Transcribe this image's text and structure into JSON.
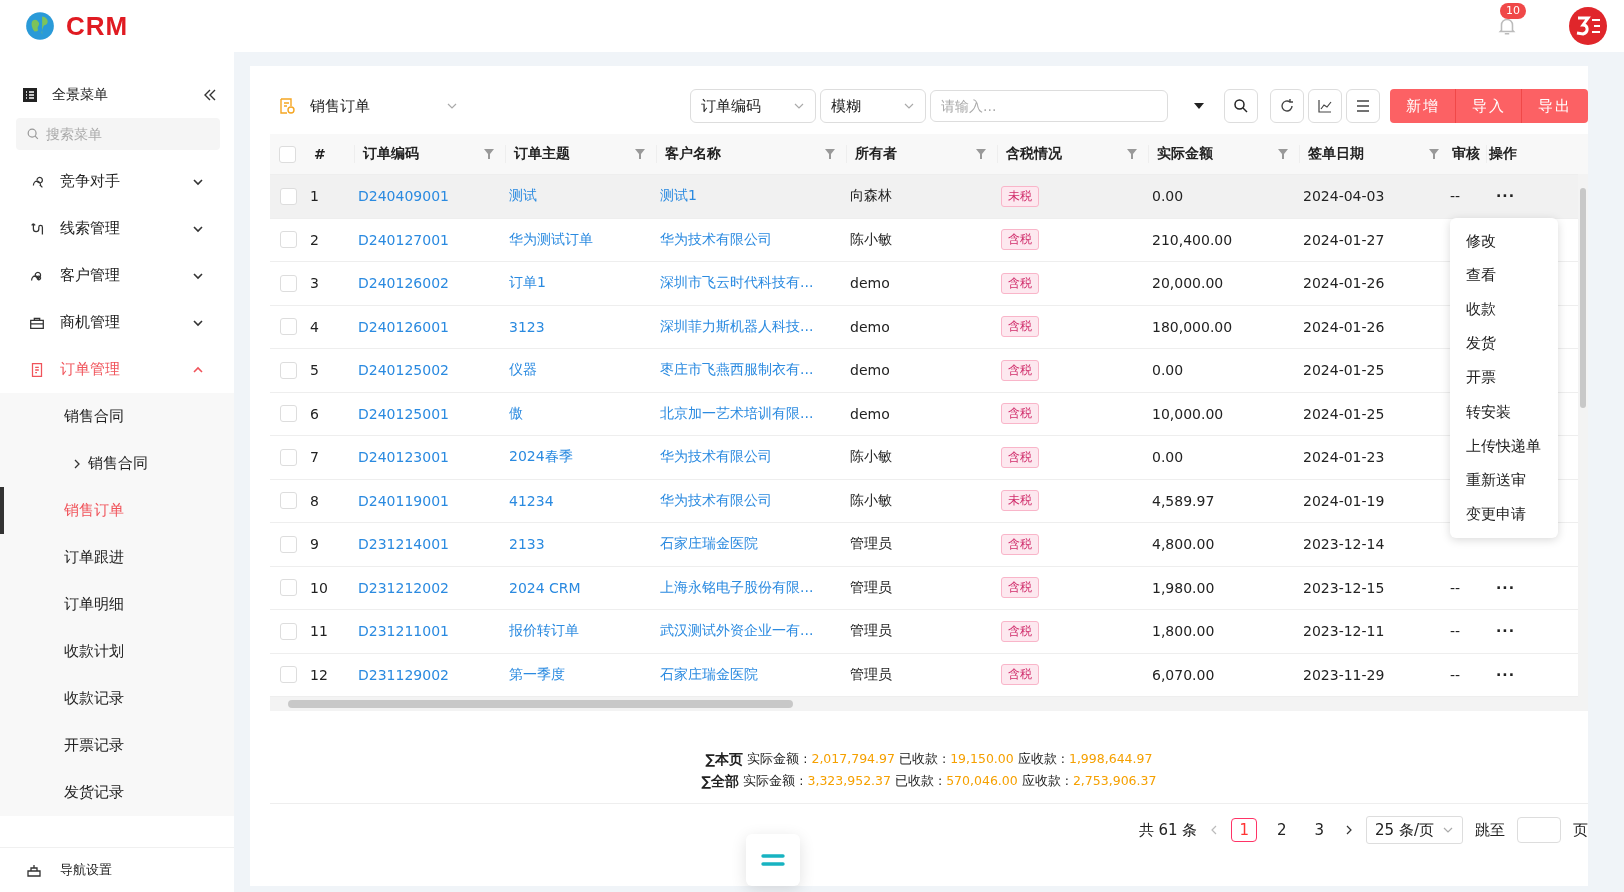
{
  "header": {
    "logo_text": "CRM",
    "notification_count": "10"
  },
  "sidebar": {
    "title": "全景菜单",
    "search": {
      "placeholder": "搜索菜单"
    },
    "items": [
      {
        "label": "竞争对手",
        "expanded": false,
        "selected": false
      },
      {
        "label": "线索管理",
        "expanded": false,
        "selected": false
      },
      {
        "label": "客户管理",
        "expanded": false,
        "selected": false
      },
      {
        "label": "商机管理",
        "expanded": false,
        "selected": false
      },
      {
        "label": "订单管理",
        "expanded": true,
        "selected": true,
        "children": [
          {
            "label": "销售合同",
            "selected": false,
            "children": [
              {
                "label": "销售合同",
                "expanded": false,
                "selected": false
              }
            ]
          },
          {
            "label": "销售订单",
            "selected": true
          },
          {
            "label": "订单跟进",
            "selected": false
          },
          {
            "label": "订单明细",
            "selected": false
          },
          {
            "label": "收款计划",
            "selected": false
          },
          {
            "label": "收款记录",
            "selected": false
          },
          {
            "label": "开票记录",
            "selected": false
          },
          {
            "label": "发货记录",
            "selected": false
          }
        ]
      }
    ],
    "footer": "导航设置"
  },
  "toolbar": {
    "module": "销售订单",
    "field": "订单编码",
    "mode": "模糊",
    "search": {
      "placeholder": "请输入..."
    },
    "buttons": [
      "新增",
      "导入",
      "导出"
    ]
  },
  "table": {
    "select_all_checked": false,
    "columns": [
      "#",
      "订单编码",
      "订单主题",
      "客户名称",
      "所有者",
      "含税情况",
      "实际金额",
      "签单日期",
      "审核",
      "操作"
    ],
    "rows": [
      {
        "no": "1",
        "code": "D240409001",
        "subject": "测试",
        "customer": "测试1",
        "owner": "向森林",
        "tax": "未税",
        "amount": "0.00",
        "date": "2024-04-03",
        "audit": "--",
        "ops": "···",
        "checked": false,
        "selected": true
      },
      {
        "no": "2",
        "code": "D240127001",
        "subject": "华为测试订单",
        "customer": "华为技术有限公司",
        "owner": "陈小敏",
        "tax": "含税",
        "amount": "210,400.00",
        "date": "2024-01-27",
        "checked": false,
        "selected": false
      },
      {
        "no": "3",
        "code": "D240126002",
        "subject": "订单1",
        "customer": "深圳市飞云时代科技有...",
        "owner": "demo",
        "tax": "含税",
        "amount": "20,000.00",
        "date": "2024-01-26",
        "checked": false,
        "selected": false
      },
      {
        "no": "4",
        "code": "D240126001",
        "subject": "3123",
        "customer": "深圳菲力斯机器人科技...",
        "owner": "demo",
        "tax": "含税",
        "amount": "180,000.00",
        "date": "2024-01-26",
        "checked": false,
        "selected": false
      },
      {
        "no": "5",
        "code": "D240125002",
        "subject": "仪器",
        "customer": "枣庄市飞燕西服制衣有...",
        "owner": "demo",
        "tax": "含税",
        "amount": "0.00",
        "date": "2024-01-25",
        "checked": false,
        "selected": false
      },
      {
        "no": "6",
        "code": "D240125001",
        "subject": "傲",
        "customer": "北京加一艺术培训有限...",
        "owner": "demo",
        "tax": "含税",
        "amount": "10,000.00",
        "date": "2024-01-25",
        "checked": false,
        "selected": false
      },
      {
        "no": "7",
        "code": "D240123001",
        "subject": "2024春季",
        "customer": "华为技术有限公司",
        "owner": "陈小敏",
        "tax": "含税",
        "amount": "0.00",
        "date": "2024-01-23",
        "checked": false,
        "selected": false
      },
      {
        "no": "8",
        "code": "D240119001",
        "subject": "41234",
        "customer": "华为技术有限公司",
        "owner": "陈小敏",
        "tax": "未税",
        "amount": "4,589.97",
        "date": "2024-01-19",
        "checked": false,
        "selected": false
      },
      {
        "no": "9",
        "code": "D231214001",
        "subject": "2133",
        "customer": "石家庄瑞金医院",
        "owner": "管理员",
        "tax": "含税",
        "amount": "4,800.00",
        "date": "2023-12-14",
        "checked": false,
        "selected": false
      },
      {
        "no": "10",
        "code": "D231212002",
        "subject": "2024 CRM",
        "customer": "上海永铭电子股份有限...",
        "owner": "管理员",
        "tax": "含税",
        "amount": "1,980.00",
        "date": "2023-12-15",
        "audit": "--",
        "ops": "···",
        "checked": false,
        "selected": false
      },
      {
        "no": "11",
        "code": "D231211001",
        "subject": "报价转订单",
        "customer": "武汉测试外资企业一有...",
        "owner": "管理员",
        "tax": "含税",
        "amount": "1,800.00",
        "date": "2023-12-11",
        "audit": "--",
        "ops": "···",
        "checked": false,
        "selected": false
      },
      {
        "no": "12",
        "code": "D231129002",
        "subject": "第一季度",
        "customer": "石家庄瑞金医院",
        "owner": "管理员",
        "tax": "含税",
        "amount": "6,070.00",
        "date": "2023-11-29",
        "audit": "--",
        "ops": "···",
        "checked": false,
        "selected": false
      }
    ],
    "row_menu": [
      "修改",
      "查看",
      "收款",
      "发货",
      "开票",
      "转安装",
      "上传快递单",
      "重新送审",
      "变更申请"
    ]
  },
  "summary": [
    {
      "label": "∑本页",
      "items": [
        {
          "name": "实际金额 :",
          "value": "2,017,794.97"
        },
        {
          "name": "已收款 :",
          "value": "19,150.00"
        },
        {
          "name": "应收款 :",
          "value": "1,998,644.97"
        }
      ]
    },
    {
      "label": "∑全部",
      "items": [
        {
          "name": "实际金额 :",
          "value": "3,323,952.37"
        },
        {
          "name": "已收款 :",
          "value": "570,046.00"
        },
        {
          "name": "应收款 :",
          "value": "2,753,906.37"
        }
      ]
    }
  ],
  "pagination": {
    "total": "共 61 条",
    "pages": [
      {
        "label": "1",
        "selected": true
      },
      {
        "label": "2",
        "selected": false
      },
      {
        "label": "3",
        "selected": false
      }
    ],
    "page_size": "25 条/页",
    "jump_label": "跳至",
    "page_unit": "页"
  }
}
